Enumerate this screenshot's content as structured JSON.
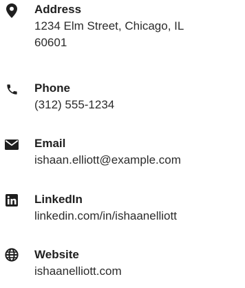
{
  "contact": {
    "items": [
      {
        "icon": "map-pin-icon",
        "label": "Address",
        "value": "1234 Elm Street, Chicago, IL 60601"
      },
      {
        "icon": "phone-icon",
        "label": "Phone",
        "value": "(312) 555-1234"
      },
      {
        "icon": "envelope-icon",
        "label": "Email",
        "value": "ishaan.elliott@example.com"
      },
      {
        "icon": "linkedin-icon",
        "label": "LinkedIn",
        "value": "linkedin.com/in/ishaanelliott"
      },
      {
        "icon": "globe-icon",
        "label": "Website",
        "value": "ishaanelliott.com"
      }
    ]
  },
  "colors": {
    "icon": "#1f1f1f",
    "text": "#2b2b2b"
  }
}
